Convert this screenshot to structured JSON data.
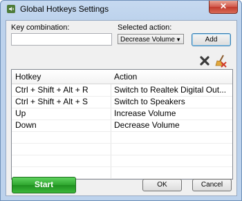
{
  "window": {
    "title": "Global Hotkeys Settings",
    "close_label": "✕"
  },
  "form": {
    "key_label": "Key combination:",
    "key_value": "",
    "action_label": "Selected action:",
    "action_selected": "Decrease Volume",
    "add_label": "Add"
  },
  "table": {
    "headers": [
      "Hotkey",
      "Action"
    ],
    "rows": [
      {
        "hotkey": "Ctrl + Shift + Alt + R",
        "action": "Switch to Realtek Digital Out..."
      },
      {
        "hotkey": "Ctrl + Shift + Alt + S",
        "action": "Switch to Speakers"
      },
      {
        "hotkey": "Up",
        "action": "Increase Volume"
      },
      {
        "hotkey": "Down",
        "action": "Decrease Volume"
      }
    ]
  },
  "footer": {
    "start_label": "Start",
    "ok_label": "OK",
    "cancel_label": "Cancel"
  },
  "icons": {
    "app": "speaker-icon",
    "delete": "delete-x-icon",
    "clear": "broom-clear-icon"
  },
  "colors": {
    "start_green": "#2ea62e",
    "close_red": "#c23a2c",
    "add_focus_border": "#3c7fb1"
  }
}
